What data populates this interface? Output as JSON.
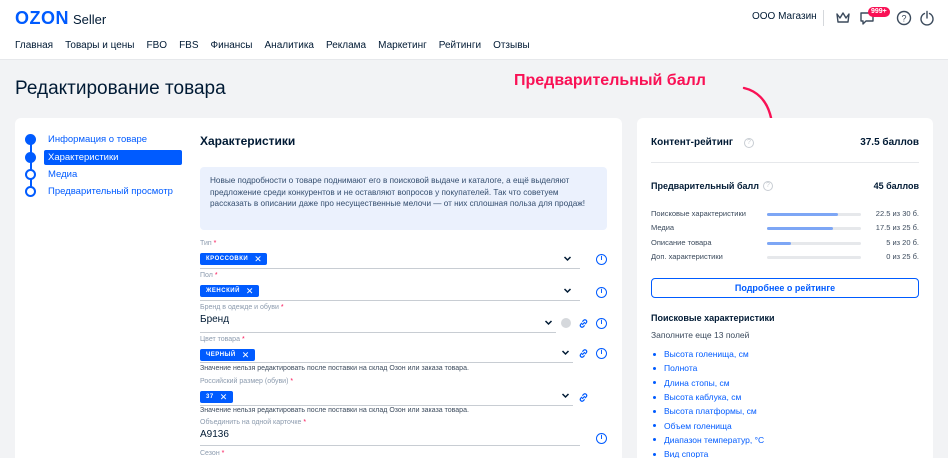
{
  "header": {
    "logo_brand": "OZON",
    "logo_product": "Seller",
    "shop_name": "ООО Магазин",
    "notifications_badge": "999+"
  },
  "nav": [
    "Главная",
    "Товары и цены",
    "FBO",
    "FBS",
    "Финансы",
    "Аналитика",
    "Реклама",
    "Маркетинг",
    "Рейтинги",
    "Отзывы"
  ],
  "page_title": "Редактирование товара",
  "annotation": "Предварительный балл",
  "steps": [
    {
      "label": "Информация о товаре",
      "state": "done"
    },
    {
      "label": "Характеристики",
      "state": "active"
    },
    {
      "label": "Медиа",
      "state": "todo"
    },
    {
      "label": "Предварительный просмотр",
      "state": "todo"
    }
  ],
  "section_title": "Характеристики",
  "info_text": "Новые подробности о товаре поднимают его в поисковой выдаче и каталоге, а ещё выделяют предложение среди конкурентов и не оставляют вопросов у покупателей. Так что советуем рассказать в описании даже про несущественные мелочи — от них сплошная польза для продаж!",
  "fields": {
    "type": {
      "label": "Тип",
      "chip": "КРОССОВКИ"
    },
    "gender": {
      "label": "Пол",
      "chip": "ЖЕНСКИЙ"
    },
    "brand": {
      "label": "Бренд в одежде и обуви",
      "value": "Бренд"
    },
    "color": {
      "label": "Цвет товара",
      "chip": "ЧЕРНЫЙ",
      "hint": "Значение нельзя редактировать после поставки на склад Озон или заказа товара."
    },
    "size": {
      "label": "Российский размер (обуви)",
      "chip": "37",
      "hint": "Значение нельзя редактировать после поставки на склад Озон или заказа товара."
    },
    "merge": {
      "label": "Объединить на одной карточке",
      "value": "A9136"
    },
    "season": {
      "label": "Сезон"
    }
  },
  "rating": {
    "content_title": "Контент-рейтинг",
    "content_score": "37.5 баллов",
    "preliminary_title": "Предварительный балл",
    "preliminary_score": "45 баллов",
    "metrics": [
      {
        "label": "Поисковые характеристики",
        "value": "22.5 из 30 б.",
        "progress": 0.75
      },
      {
        "label": "Медиа",
        "value": "17.5 из 25 б.",
        "progress": 0.7
      },
      {
        "label": "Описание товара",
        "value": "5 из 20 б.",
        "progress": 0.25
      },
      {
        "label": "Доп. характеристики",
        "value": "0 из 25 б.",
        "progress": 0
      }
    ],
    "more_button": "Подробнее о рейтинге",
    "search_title": "Поисковые характеристики",
    "search_subtitle": "Заполните еще 13 полей",
    "missing_fields": [
      "Высота голенища, см",
      "Полнота",
      "Длина стопы, см",
      "Высота каблука, см",
      "Высота платформы, см",
      "Объем голенища",
      "Диапазон температур, °С",
      "Вид спорта"
    ]
  },
  "colors": {
    "accent": "#005bff",
    "annotation": "#f91155",
    "badge": "#f91155"
  }
}
